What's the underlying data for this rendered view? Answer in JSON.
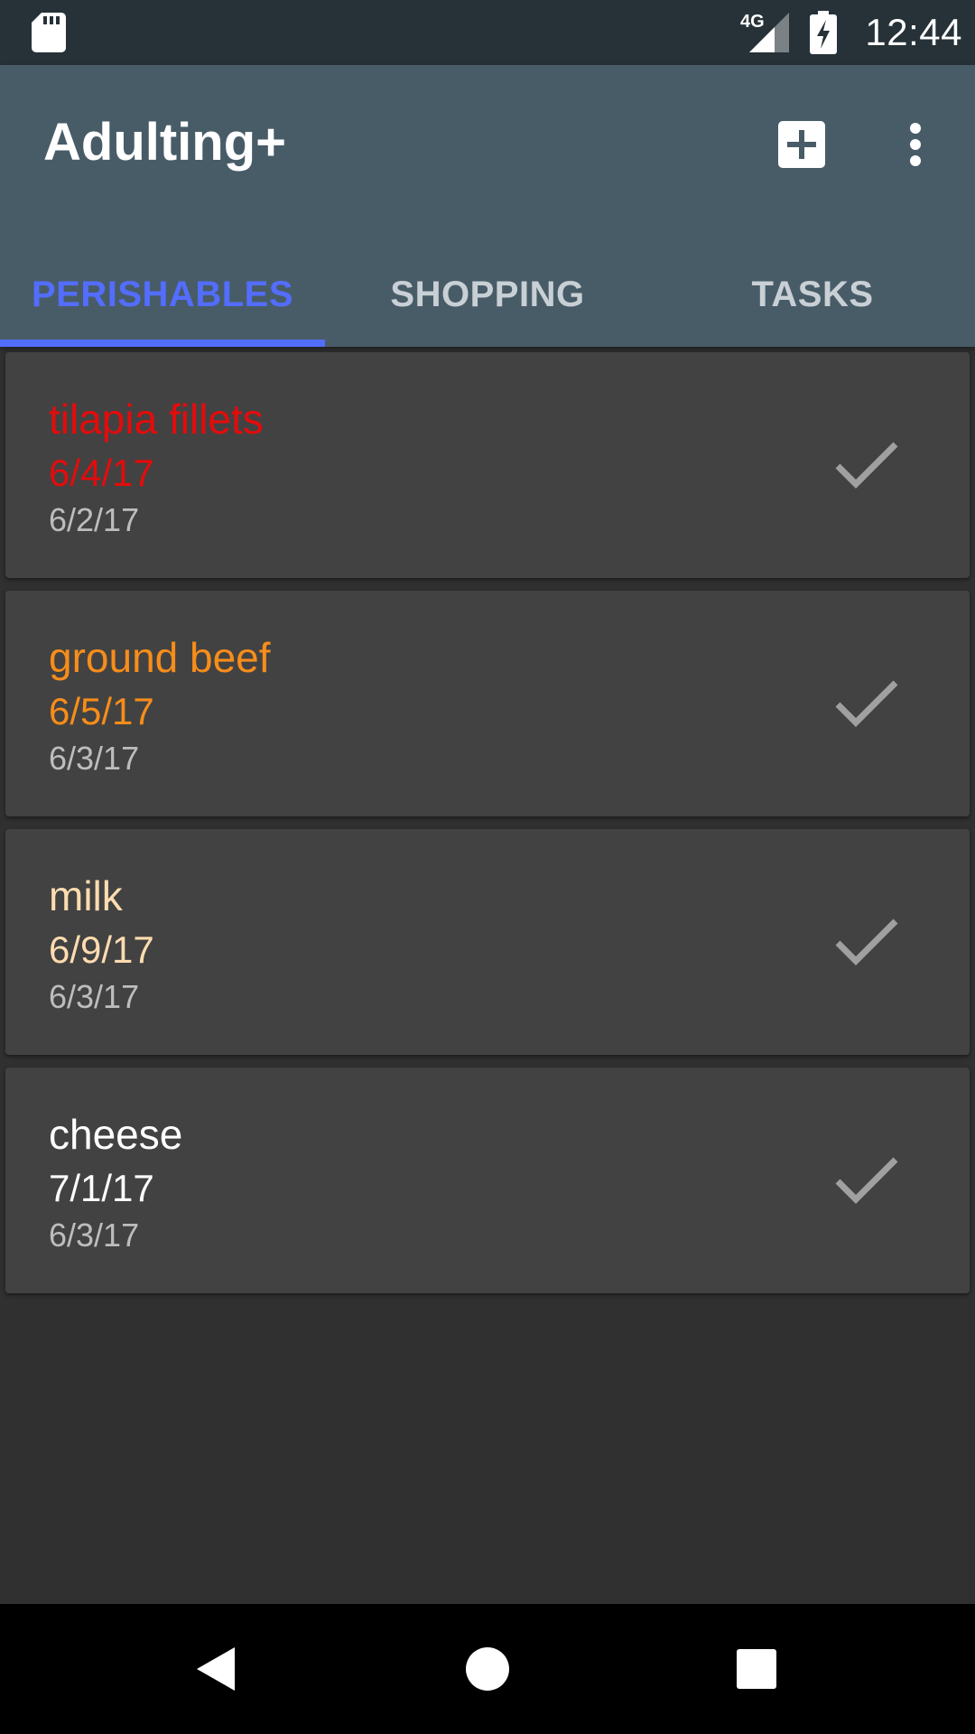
{
  "status_bar": {
    "time": "12:44",
    "network_label": "4G",
    "icons": [
      "sd-card-icon",
      "cellular-signal-icon",
      "battery-charging-icon"
    ]
  },
  "app_bar": {
    "title": "Adulting+",
    "actions": [
      "add-box-icon",
      "more-vert-icon"
    ]
  },
  "tabs": [
    {
      "label": "PERISHABLES",
      "active": true
    },
    {
      "label": "SHOPPING",
      "active": false
    },
    {
      "label": "TASKS",
      "active": false
    }
  ],
  "items": [
    {
      "name": "tilapia fillets",
      "expiry": "6/4/17",
      "added": "6/2/17",
      "color": "#e50b0b"
    },
    {
      "name": "ground beef",
      "expiry": "6/5/17",
      "added": "6/3/17",
      "color": "#f78d1a"
    },
    {
      "name": "milk",
      "expiry": "6/9/17",
      "added": "6/3/17",
      "color": "#ffdcb0"
    },
    {
      "name": "cheese",
      "expiry": "7/1/17",
      "added": "6/3/17",
      "color": "#ffffff"
    }
  ],
  "nav_bar": {
    "icons": [
      "back-icon",
      "home-icon",
      "recents-icon"
    ]
  },
  "colors": {
    "accent": "#536dfe",
    "app_bar": "#485c68",
    "status_bar": "#263238",
    "card": "#424242",
    "background": "#303030"
  }
}
